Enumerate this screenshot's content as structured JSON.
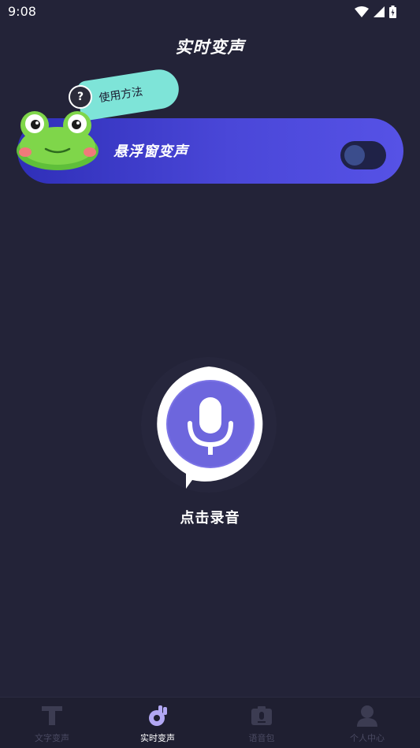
{
  "status_bar": {
    "time": "9:08"
  },
  "header": {
    "title": "实时变声"
  },
  "float_window": {
    "label": "悬浮窗变声",
    "help_label": "使用方法",
    "help_icon_text": "?",
    "toggle_on": false
  },
  "record": {
    "label": "点击录音",
    "icon": "microphone-icon"
  },
  "bottom_nav": {
    "items": [
      {
        "label": "文字变声",
        "icon": "text-t-icon",
        "active": false
      },
      {
        "label": "实时变声",
        "icon": "realtime-voice-icon",
        "active": true
      },
      {
        "label": "语音包",
        "icon": "voice-pack-icon",
        "active": false
      },
      {
        "label": "个人中心",
        "icon": "user-icon",
        "active": false
      }
    ]
  },
  "colors": {
    "background": "#232338",
    "card": "#4a47d8",
    "accent": "#7b73e6",
    "bubble": "#7ee4d8"
  }
}
